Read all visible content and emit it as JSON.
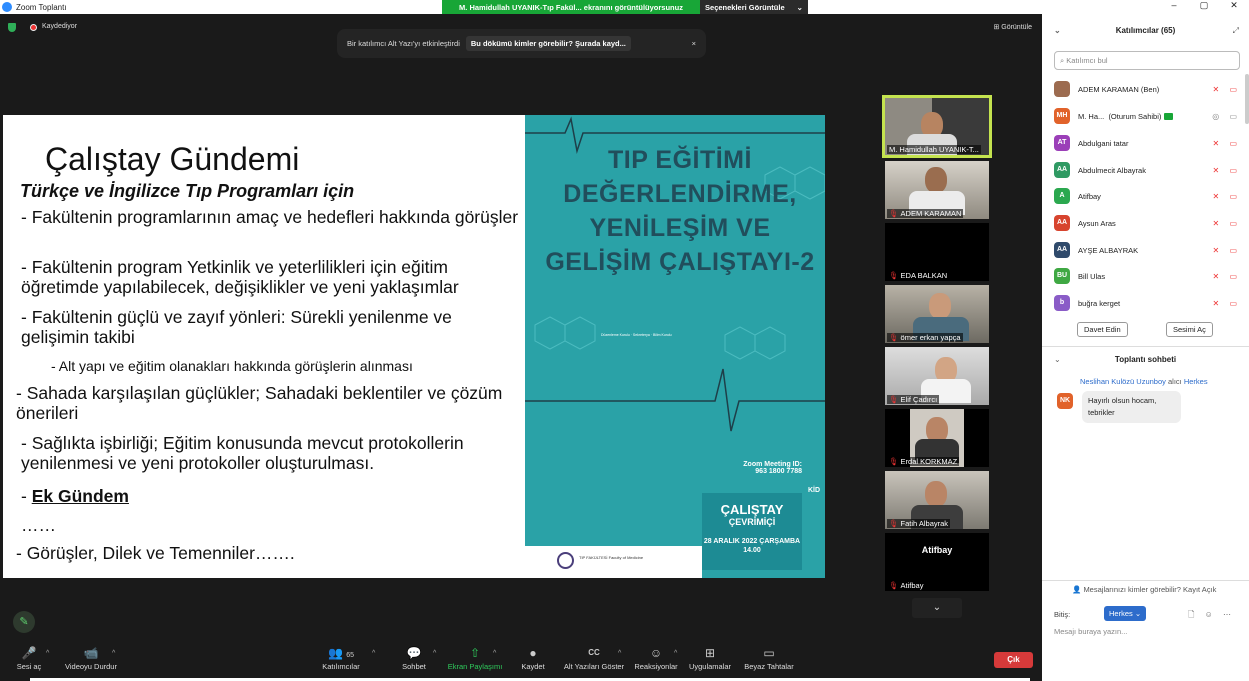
{
  "window": {
    "title": "Zoom Toplantı",
    "controls": [
      "–",
      "▢",
      "✕"
    ]
  },
  "share": {
    "banner": "M. Hamidullah UYANIK-Tıp Fakül... ekranını görüntülüyorsunuz",
    "options": "Seçenekleri Görüntüle",
    "options_caret": "⌄"
  },
  "status": {
    "recording": "Kaydediyor",
    "view": "Görüntüle"
  },
  "notice": {
    "text": "Bir katılımcı Alt Yazı'yı etkinleştirdi",
    "link": "Bu dökümü kimler görebilir? Şurada kayd...",
    "close": "×"
  },
  "slide": {
    "title": "Çalıştay Gündemi",
    "subtitle": "Türkçe ve İngilizce Tıp Programları için",
    "items": [
      "- Fakültenin programlarının amaç ve hedefleri hakkında görüşler",
      "- Fakültenin program Yetkinlik ve yeterlilikleri için eğitim öğretimde yapılabilecek, değişiklikler ve yeni yaklaşımlar",
      "- Fakültenin güçlü ve zayıf yönleri: Sürekli yenilenme ve gelişimin takibi",
      "- Alt yapı ve eğitim olanakları hakkında görüşlerin alınması",
      "- Sahada karşılaşılan güçlükler; Sahadaki beklentiler ve çözüm önerileri",
      "- Sağlıkta işbirliği; Eğitim konusunda mevcut protokollerin yenilenmesi ve yeni protokoller oluşturulması.",
      "- ",
      "Ek Gündem",
      "……",
      "- Görüşler, Dilek ve Temenniler……."
    ],
    "poster": {
      "heading": "TIP EĞİTİMİ DEĞERLENDİRME, YENİLEŞİM VE GELİŞİM ÇALIŞTAYI-2",
      "zoom": "Zoom Meeting ID: 963 1800 7788",
      "event": "ÇALIŞTAY",
      "mode": "ÇEVRİMİÇİ",
      "date": "28 ARALIK 2022 ÇARŞAMBA 14.00",
      "faculty": "TIP FAKÜLTESİ Faculty of Medicine",
      "kid": "KİD"
    }
  },
  "videos": [
    {
      "name": "M. Hamidullah UYANIK-T...",
      "speaking": true
    },
    {
      "name": "ADEM KARAMAN"
    },
    {
      "name": "EDA BALKAN"
    },
    {
      "name": "ömer erkan yapça"
    },
    {
      "name": "Elif Çadırcı"
    },
    {
      "name": "Erdal KORKMAZ"
    },
    {
      "name": "Fatih Albayrak"
    },
    {
      "name": "Atifbay",
      "big": "Atifbay"
    }
  ],
  "toolbar": {
    "items": [
      {
        "label": "Sesi aç",
        "icon": "🎤"
      },
      {
        "label": "Videoyu Durdur",
        "icon": "📹"
      },
      {
        "label": "Katılımcılar",
        "icon": "👥",
        "count": "65"
      },
      {
        "label": "Sohbet",
        "icon": "💬"
      },
      {
        "label": "Ekran Paylaşımı",
        "icon": "⇧"
      },
      {
        "label": "Kaydet",
        "icon": "●"
      },
      {
        "label": "Alt Yazıları Göster",
        "icon": "CC"
      },
      {
        "label": "Reaksiyonlar",
        "icon": "☺"
      },
      {
        "label": "Uygulamalar",
        "icon": "⊞"
      },
      {
        "label": "Beyaz Tahtalar",
        "icon": "▭"
      }
    ],
    "caret": "^",
    "pencil": "✎",
    "more": "⌄",
    "leave": "Çık"
  },
  "participants": {
    "header": "Katılımcılar (65)",
    "chevron": "⌄",
    "expand": "⤢",
    "search_placeholder": "Katılımcı bul",
    "list": [
      {
        "initials": "",
        "name": "ADEM KARAMAN (Ben)",
        "color": "#9c6b4f"
      },
      {
        "initials": "MH",
        "name": "M. Ha...",
        "extra": "(Oturum Sahibi)",
        "color": "#e1622a"
      },
      {
        "initials": "AT",
        "name": "Abdulgani tatar",
        "color": "#9b3fb8"
      },
      {
        "initials": "AA",
        "name": "Abdulmecit Albayrak",
        "color": "#2f9a63"
      },
      {
        "initials": "A",
        "name": "Atifbay",
        "color": "#2ba84f"
      },
      {
        "initials": "AA",
        "name": "Aysun Aras",
        "color": "#d7442e"
      },
      {
        "initials": "AA",
        "name": "AYŞE ALBAYRAK",
        "color": "#2f4a6b"
      },
      {
        "initials": "BU",
        "name": "Bill Ulas",
        "color": "#3fa843"
      },
      {
        "initials": "b",
        "name": "buğra kerget",
        "color": "#8a5cc7"
      }
    ],
    "invite": "Davet Edin",
    "unmute": "Sesimi Aç"
  },
  "chat": {
    "header": "Toplantı sohbeti",
    "chevron": "⌄",
    "sender": "Neslihan Kulözü Uzunboy",
    "to": "alıcı",
    "to_name": "Herkes",
    "initials": "NK",
    "message": "Hayırlı olsun hocam, tebrikler",
    "who_can_see": "Mesajlarınızı kimler görebilir? Kayıt Açık",
    "recipient_label": "Bitiş:",
    "recipient": "Herkes ⌄",
    "icons": "🗋 ☺ ⋯",
    "placeholder": "Mesajı buraya yazın..."
  }
}
